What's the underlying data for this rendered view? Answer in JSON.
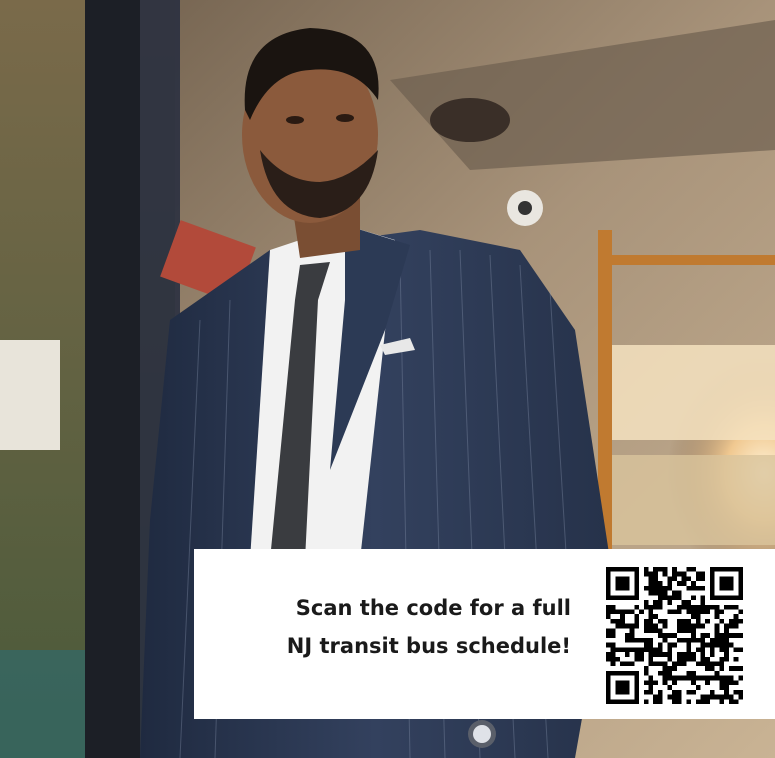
{
  "photo": {
    "subject": "businessman-stepping-off-bus",
    "colors": {
      "suit": "#2c3a55",
      "shirt": "#f2f2f2",
      "tie": "#3a3c40",
      "skin": "#8b5a3c",
      "hair": "#1a1410",
      "bus_frame": "#1c1f26",
      "ceiling": "#9a8a74",
      "sunlight": "#ffd9a0"
    }
  },
  "card": {
    "line1": "Scan the code for a full",
    "line2": "NJ transit bus schedule!",
    "qr_icon": "qr-code-icon",
    "text_color": "#1a1a1a",
    "background": "#ffffff"
  }
}
